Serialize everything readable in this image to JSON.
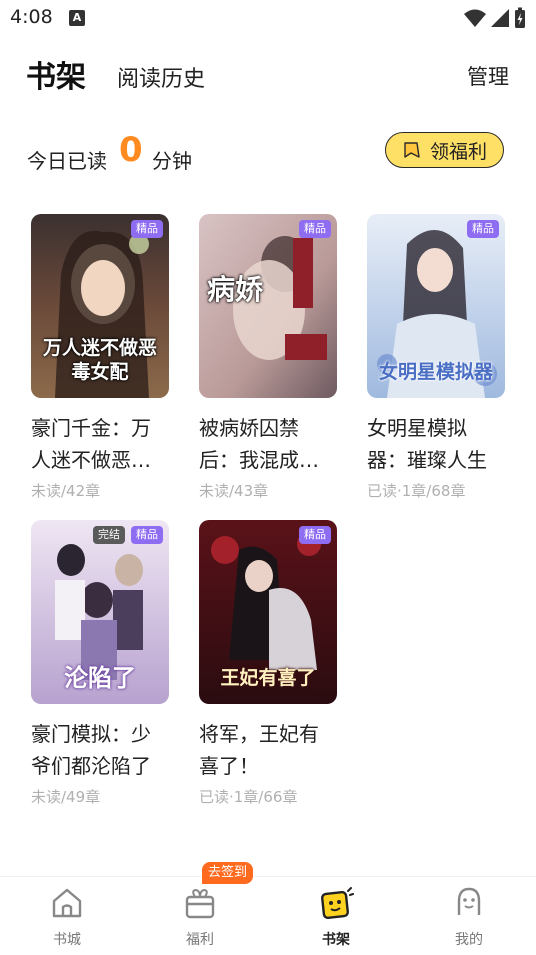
{
  "status_bar": {
    "time": "4:08",
    "notification_letter": "A"
  },
  "header": {
    "tab_bookshelf": "书架",
    "tab_history": "阅读历史",
    "manage": "管理"
  },
  "reading_stats": {
    "prefix": "今日已读",
    "minutes": "0",
    "suffix": "分钟",
    "benefit_button": "领福利"
  },
  "books": [
    {
      "title": "豪门千金：万人迷不做恶毒女配",
      "progress": "未读/42章",
      "badge": "精品",
      "cover_text": "万人迷不做恶毒女配",
      "cover_color": "#6b4a3a"
    },
    {
      "title": "被病娇囚禁后：我混成团宠",
      "progress": "未读/43章",
      "badge": "精品",
      "cover_text": "病娇",
      "cover_color": "#c9a9a0"
    },
    {
      "title": "女明星模拟器：璀璨人生",
      "progress": "已读·1章/68章",
      "badge": "精品",
      "cover_text": "女明星模拟器",
      "cover_color": "#b7cde8"
    },
    {
      "title": "豪门模拟：少爷们都沦陷了",
      "progress": "未读/49章",
      "badge": "精品",
      "badge2": "完结",
      "cover_text": "沦陷了",
      "cover_color": "#c4b3d6"
    },
    {
      "title": "将军，王妃有喜了！",
      "progress": "已读·1章/66章",
      "badge": "精品",
      "cover_text": "王妃有喜了",
      "cover_color": "#7a1f24"
    }
  ],
  "bottom_nav": {
    "items": [
      {
        "label": "书城",
        "icon": "home-icon"
      },
      {
        "label": "福利",
        "icon": "gift-icon"
      },
      {
        "label": "书架",
        "icon": "bookshelf-icon"
      },
      {
        "label": "我的",
        "icon": "profile-icon"
      }
    ],
    "signin_badge": "去签到"
  },
  "colors": {
    "accent_orange": "#ff8a1f",
    "benefit_yellow": "#ffe066",
    "badge_purple": "#8f6df2",
    "muted": "#b0b0b0"
  }
}
